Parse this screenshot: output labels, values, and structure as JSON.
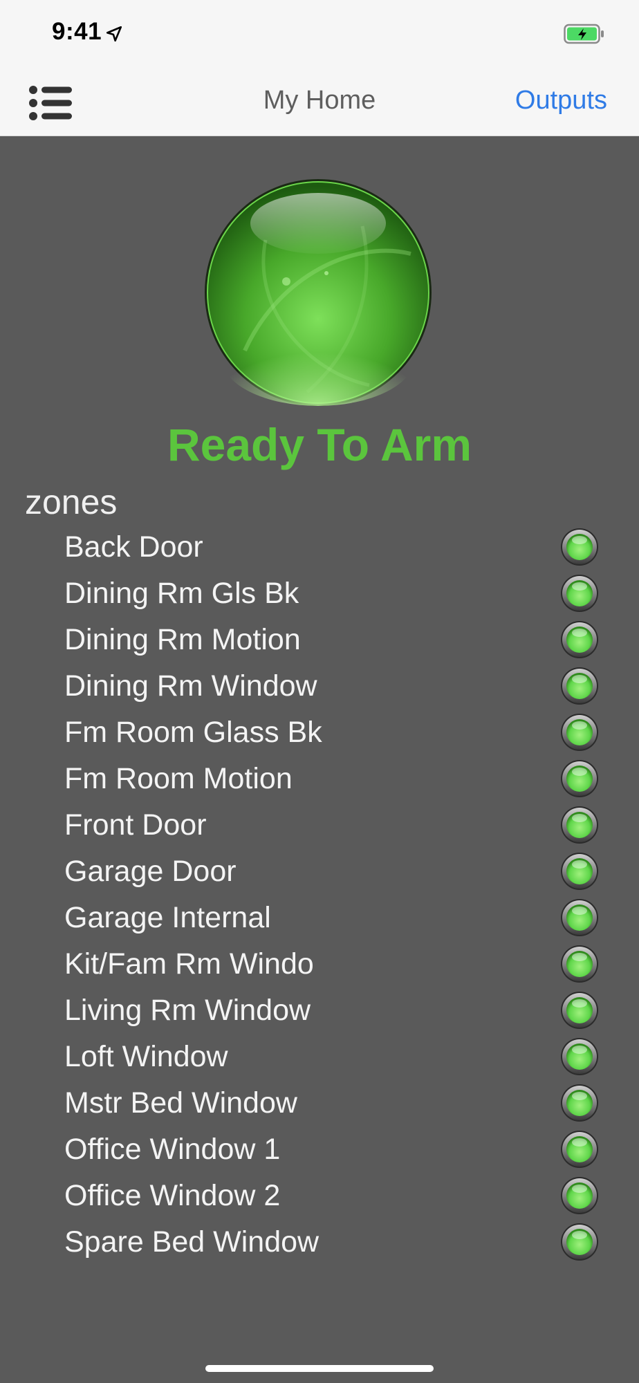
{
  "status_bar": {
    "time": "9:41",
    "icons": [
      "location-arrow-icon",
      "battery-charging-icon"
    ]
  },
  "nav": {
    "menu_icon": "list-icon",
    "title": "My Home",
    "outputs_label": "Outputs"
  },
  "panel": {
    "status": "Ready To Arm",
    "status_color": "#5bc53d",
    "orb_color": "#4caf2a"
  },
  "zones": {
    "header": "zones",
    "led_color": "#5fd64a",
    "items": [
      {
        "label": "Back Door"
      },
      {
        "label": "Dining Rm Gls Bk"
      },
      {
        "label": "Dining Rm Motion"
      },
      {
        "label": "Dining Rm Window"
      },
      {
        "label": "Fm Room Glass Bk"
      },
      {
        "label": "Fm Room Motion"
      },
      {
        "label": "Front Door"
      },
      {
        "label": "Garage Door"
      },
      {
        "label": "Garage Internal"
      },
      {
        "label": "Kit/Fam Rm Windo"
      },
      {
        "label": "Living Rm Window"
      },
      {
        "label": "Loft Window"
      },
      {
        "label": "Mstr Bed Window"
      },
      {
        "label": "Office Window 1"
      },
      {
        "label": "Office Window 2"
      },
      {
        "label": "Spare Bed Window"
      }
    ]
  }
}
